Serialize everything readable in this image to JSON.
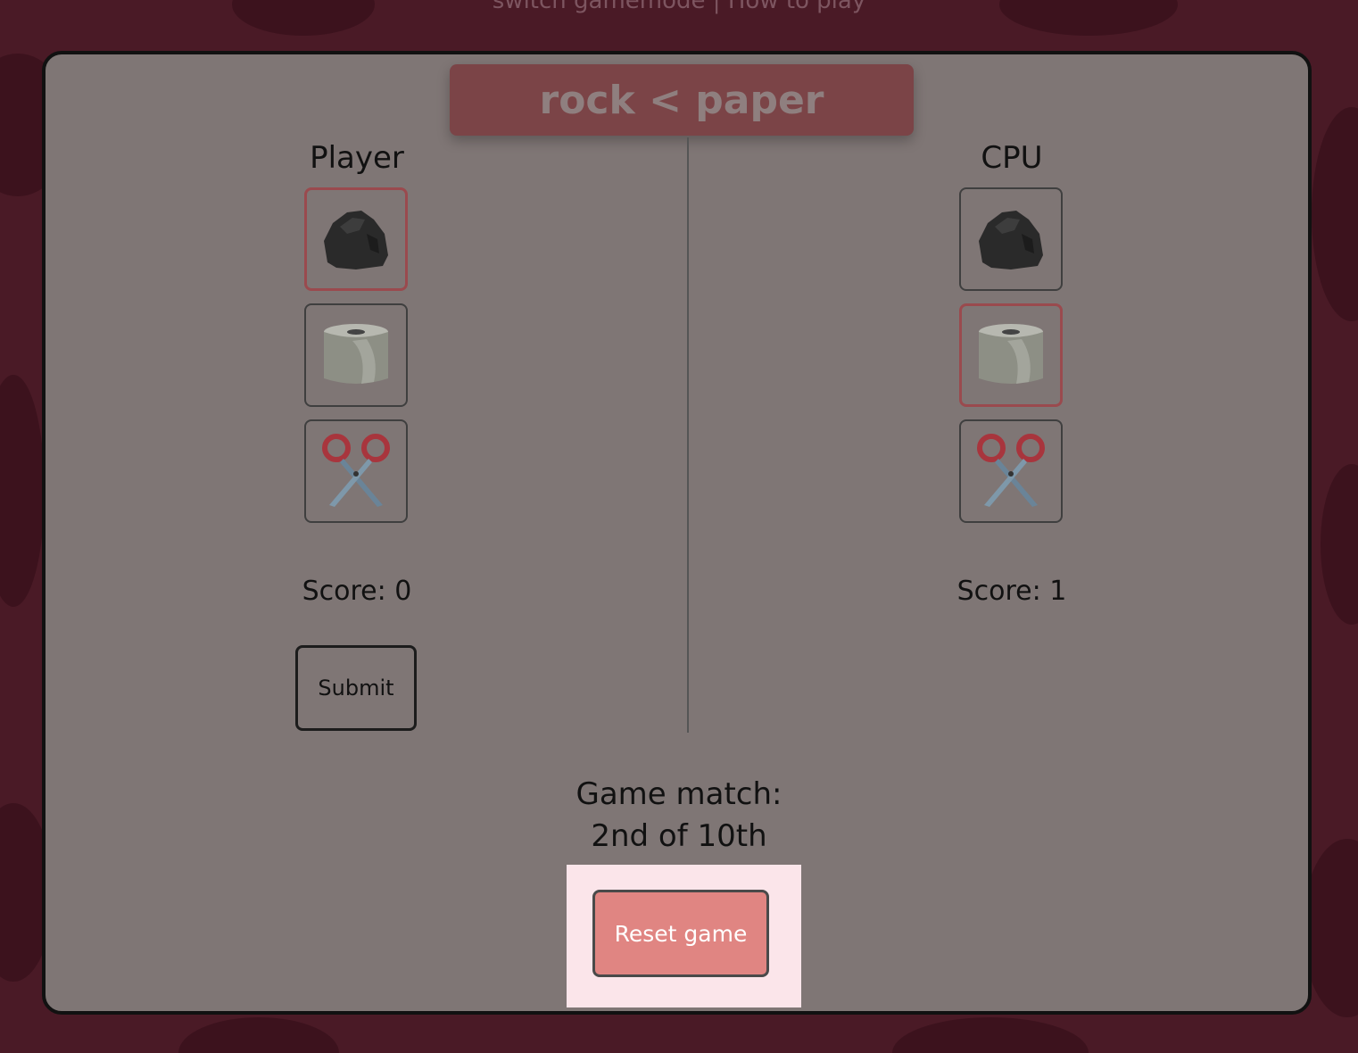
{
  "nav": {
    "switch_label": "switch gamemode",
    "separator": "|",
    "howto_label": "How to play"
  },
  "result": {
    "text": "rock < paper"
  },
  "player": {
    "title": "Player",
    "selected": "rock",
    "score_text": "Score: 0",
    "submit_label": "Submit"
  },
  "cpu": {
    "title": "CPU",
    "selected": "paper",
    "score_text": "Score: 1"
  },
  "choices": [
    "rock-icon",
    "paper-icon",
    "scissors-icon"
  ],
  "match": {
    "line1": "Game match:",
    "line2": "2nd of 10th"
  },
  "reset": {
    "label": "Reset game"
  },
  "colors": {
    "background": "#4a1a26",
    "panel": "#7f7675",
    "banner": "#7b4447",
    "selected_border": "#9a4a4e",
    "reset_button": "#e08582",
    "reset_highlight": "#fbe5ea"
  }
}
